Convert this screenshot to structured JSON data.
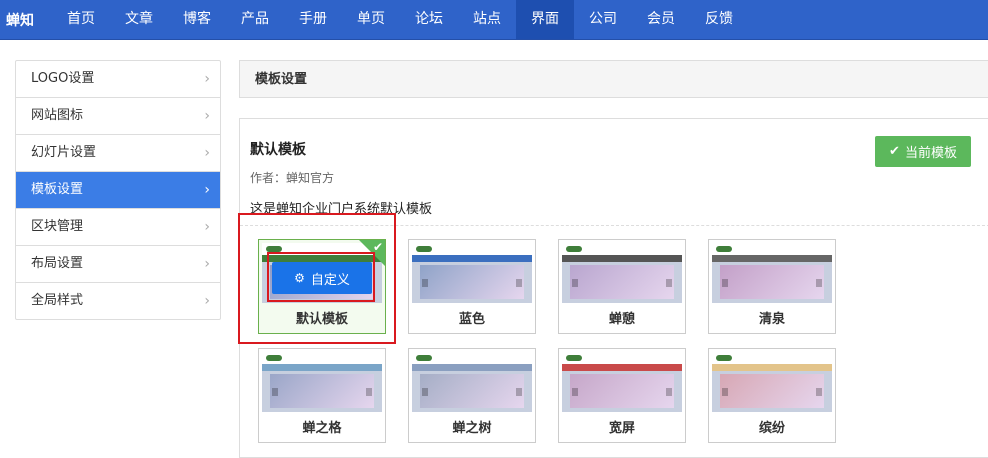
{
  "brand": "蝉知",
  "nav": [
    "首页",
    "文章",
    "博客",
    "产品",
    "手册",
    "单页",
    "论坛",
    "站点",
    "界面",
    "公司",
    "会员",
    "反馈"
  ],
  "nav_active_index": 8,
  "sidebar": {
    "items": [
      {
        "label": "LOGO设置"
      },
      {
        "label": "网站图标"
      },
      {
        "label": "幻灯片设置"
      },
      {
        "label": "模板设置"
      },
      {
        "label": "区块管理"
      },
      {
        "label": "布局设置"
      },
      {
        "label": "全局样式"
      }
    ],
    "active_index": 3,
    "chevron": "›"
  },
  "panel_head": "模板设置",
  "template": {
    "title": "默认模板",
    "author": "作者：蝉知官方",
    "description": "这是蝉知企业门户系统默认模板",
    "current_button": "当前模板",
    "customize_button": "自定义"
  },
  "cards": [
    {
      "label": "默认模板",
      "theme": "default",
      "selected": true,
      "colors": {
        "nav": "#3f7e3a",
        "slide": "#8e9cc6"
      }
    },
    {
      "label": "蓝色",
      "theme": "blue",
      "colors": {
        "nav": "#3b6fbf",
        "slide": "#8fa3c8"
      }
    },
    {
      "label": "蝉憩",
      "theme": "rest",
      "colors": {
        "nav": "#555555",
        "slide": "#b9a6cf"
      }
    },
    {
      "label": "清泉",
      "theme": "spring",
      "colors": {
        "nav": "#666666",
        "slide": "#c3a0c8"
      }
    },
    {
      "label": "蝉之格",
      "theme": "grid",
      "colors": {
        "nav": "#7aa5c8",
        "slide": "#9aa6c8"
      }
    },
    {
      "label": "蝉之树",
      "theme": "tree",
      "colors": {
        "nav": "#8a9fc0",
        "slide": "#a5aec6"
      }
    },
    {
      "label": "宽屏",
      "theme": "wide",
      "colors": {
        "nav": "#c94a4a",
        "slide": "#c6a7c9"
      }
    },
    {
      "label": "缤纷",
      "theme": "colorful",
      "colors": {
        "nav": "#e3c48a",
        "slide": "#d7a7b4"
      }
    }
  ],
  "colors": {
    "accent": "#2f63c9",
    "active": "#3b7de6",
    "success": "#5cb85c",
    "highlight": "#d9191f"
  }
}
